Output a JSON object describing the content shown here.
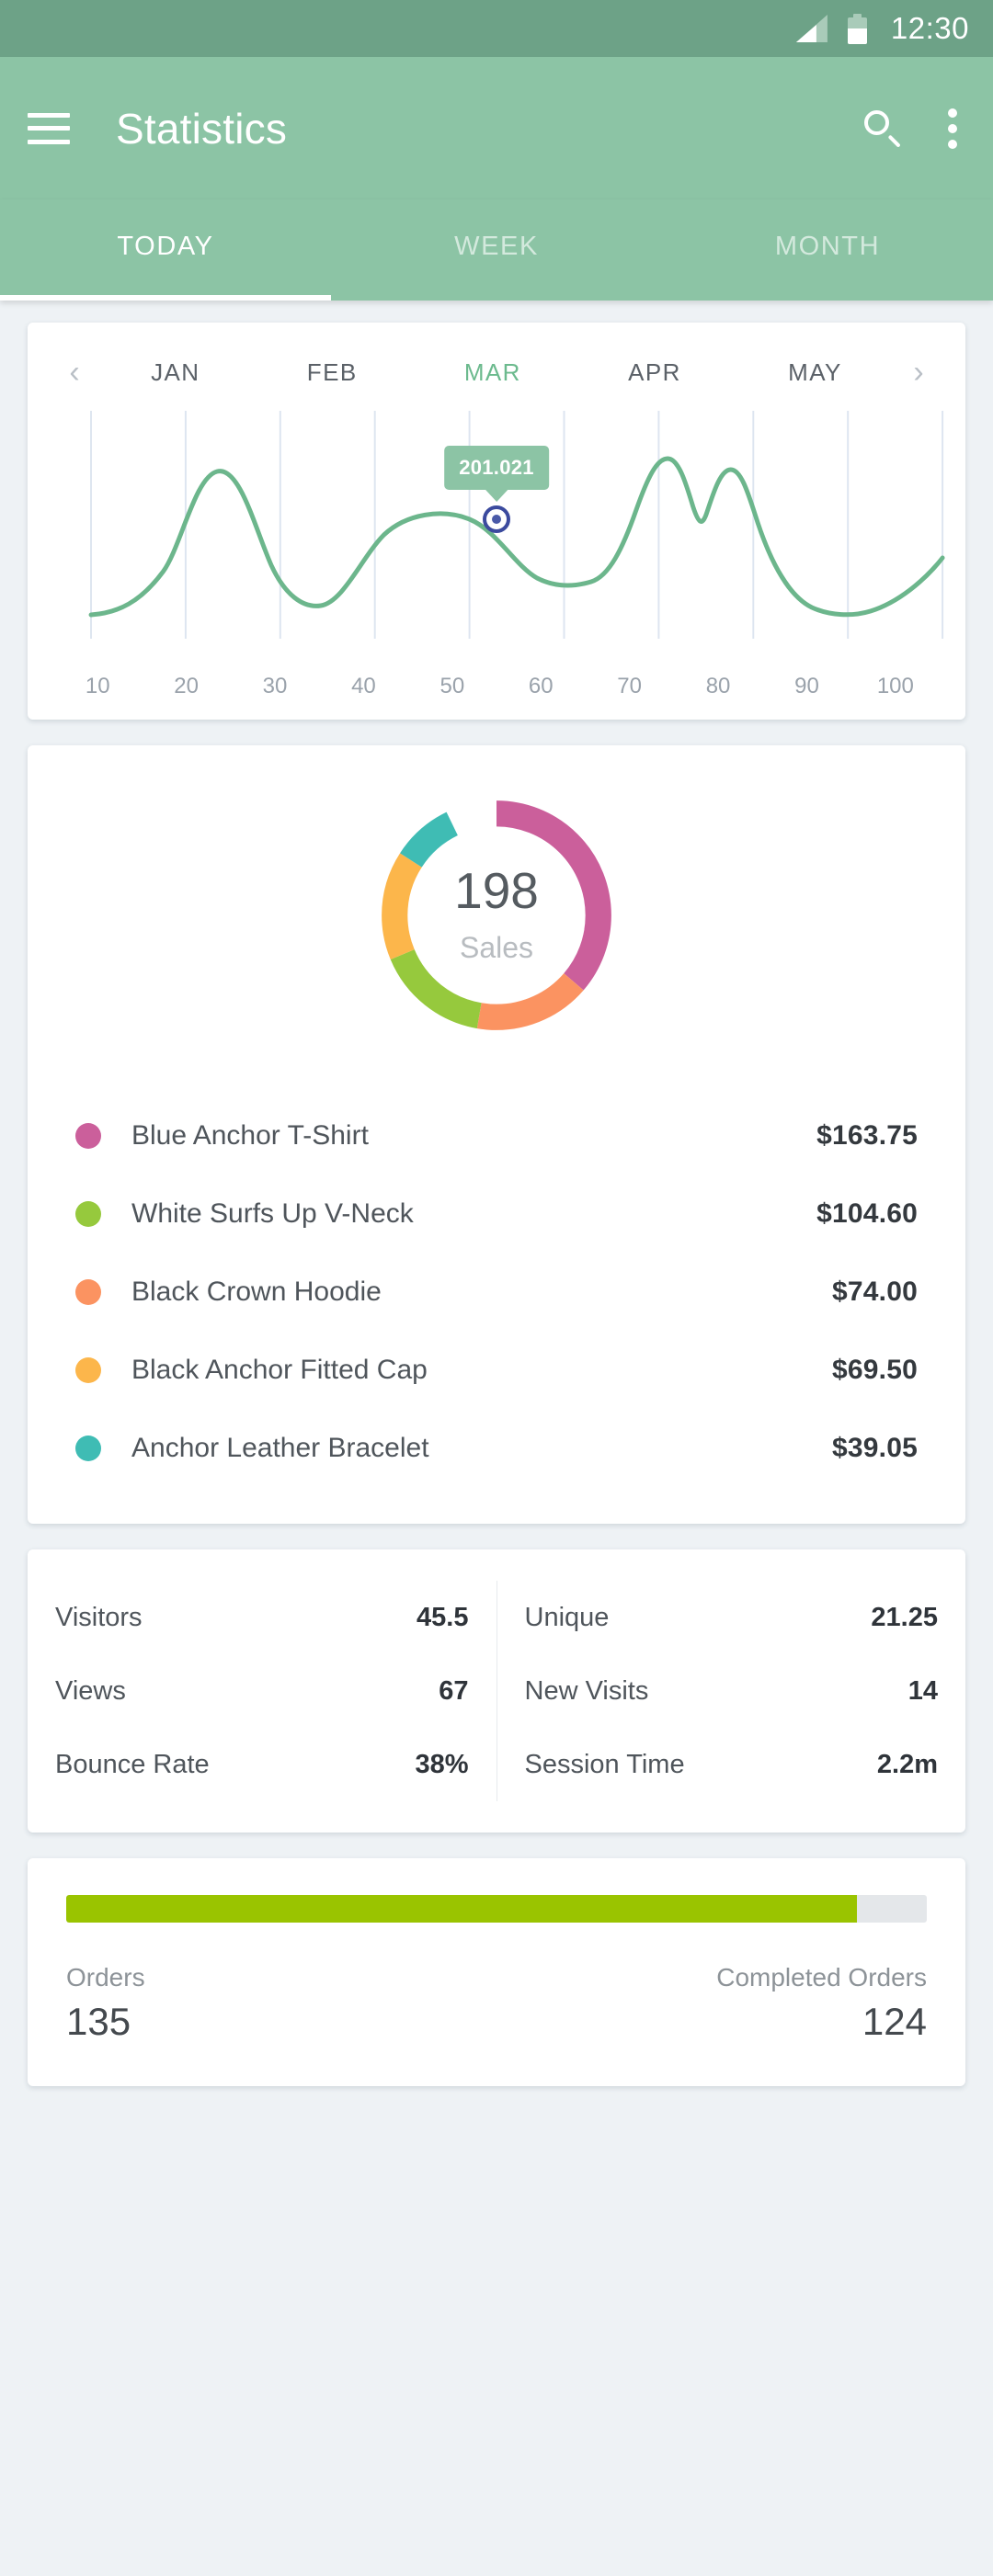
{
  "status_bar": {
    "time": "12:30",
    "signal_icon": "signal-bars-icon",
    "battery_icon": "battery-icon"
  },
  "appbar": {
    "menu_icon": "hamburger-menu-icon",
    "title": "Statistics",
    "search_icon": "search-icon",
    "overflow_icon": "overflow-menu-icon"
  },
  "tabs": [
    {
      "label": "TODAY",
      "active": true
    },
    {
      "label": "WEEK",
      "active": false
    },
    {
      "label": "MONTH",
      "active": false
    }
  ],
  "line_chart_card": {
    "prev_arrow": "‹",
    "next_arrow": "›",
    "months": [
      {
        "label": "JAN",
        "active": false
      },
      {
        "label": "FEB",
        "active": false
      },
      {
        "label": "MAR",
        "active": true
      },
      {
        "label": "APR",
        "active": false
      },
      {
        "label": "MAY",
        "active": false
      }
    ],
    "tooltip_value": "201.021"
  },
  "donut_card": {
    "center_value": "198",
    "center_label": "Sales",
    "legend": [
      {
        "name": "Blue Anchor T-Shirt",
        "value": "$163.75",
        "color": "#cb5f9b"
      },
      {
        "name": "White Surfs Up V-Neck",
        "value": "$104.60",
        "color": "#96c93d"
      },
      {
        "name": "Black Crown Hoodie",
        "value": "$74.00",
        "color": "#fb9361"
      },
      {
        "name": "Black Anchor Fitted Cap",
        "value": "$69.50",
        "color": "#fcb64b"
      },
      {
        "name": "Anchor Leather Bracelet",
        "value": "$39.05",
        "color": "#3fbcb4"
      }
    ]
  },
  "stats_card": {
    "left": [
      {
        "label": "Visitors",
        "value": "45.5"
      },
      {
        "label": "Views",
        "value": "67"
      },
      {
        "label": "Bounce Rate",
        "value": "38%"
      }
    ],
    "right": [
      {
        "label": "Unique",
        "value": "21.25"
      },
      {
        "label": "New Visits",
        "value": "14"
      },
      {
        "label": "Session Time",
        "value": "2.2m"
      }
    ]
  },
  "orders_card": {
    "progress_percent": 91.9,
    "progress_color": "#9ac400",
    "orders_label": "Orders",
    "orders_value": "135",
    "completed_label": "Completed Orders",
    "completed_value": "124"
  },
  "theme": {
    "status_bar_bg": "#6da287",
    "appbar_bg": "#8cc4a5",
    "page_bg": "#eef2f5",
    "accent_green": "#6cba8e",
    "line_color": "#6cb68c"
  },
  "chart_data": [
    {
      "type": "line",
      "title": "",
      "xlabel": "",
      "ylabel": "",
      "xlim": [
        5,
        105
      ],
      "ylim": [
        0,
        260
      ],
      "grid": true,
      "legend": "none",
      "tick_labels": [
        "10",
        "20",
        "30",
        "40",
        "50",
        "60",
        "70",
        "80",
        "90",
        "100"
      ],
      "highlight": {
        "x": 50,
        "label": "201.021"
      },
      "series": [
        {
          "name": "Sales",
          "color": "#6cb68c",
          "x": [
            10,
            15,
            20,
            24,
            28,
            32,
            36,
            40,
            44,
            47,
            50,
            54,
            58,
            62,
            66,
            69,
            71,
            73,
            74,
            75,
            76,
            78,
            82,
            86,
            89,
            93,
            97,
            100
          ],
          "y": [
            22,
            28,
            55,
            110,
            185,
            140,
            72,
            48,
            120,
            180,
            201,
            185,
            120,
            82,
            130,
            215,
            238,
            180,
            160,
            205,
            222,
            150,
            70,
            32,
            24,
            38,
            75,
            118
          ]
        }
      ]
    },
    {
      "type": "pie",
      "title": "Sales",
      "center_value": 198,
      "donut": true,
      "labels": [
        "Blue Anchor T-Shirt",
        "White Surfs Up V-Neck",
        "Black Crown Hoodie",
        "Black Anchor Fitted Cap",
        "Anchor Leather Bracelet"
      ],
      "values": [
        163.75,
        104.6,
        74.0,
        69.5,
        39.05
      ],
      "percent": [
        36.3,
        23.2,
        16.4,
        15.4,
        8.7
      ],
      "colors": [
        "#cb5f9b",
        "#96c93d",
        "#fb9361",
        "#fcb64b",
        "#3fbcb4"
      ],
      "units": "USD"
    },
    {
      "type": "bar",
      "title": "Orders progress",
      "categories": [
        "Completed Orders",
        "Orders"
      ],
      "values": [
        124,
        135
      ],
      "ylim": [
        0,
        135
      ],
      "colors": [
        "#9ac400",
        "#e4e7ea"
      ]
    }
  ]
}
